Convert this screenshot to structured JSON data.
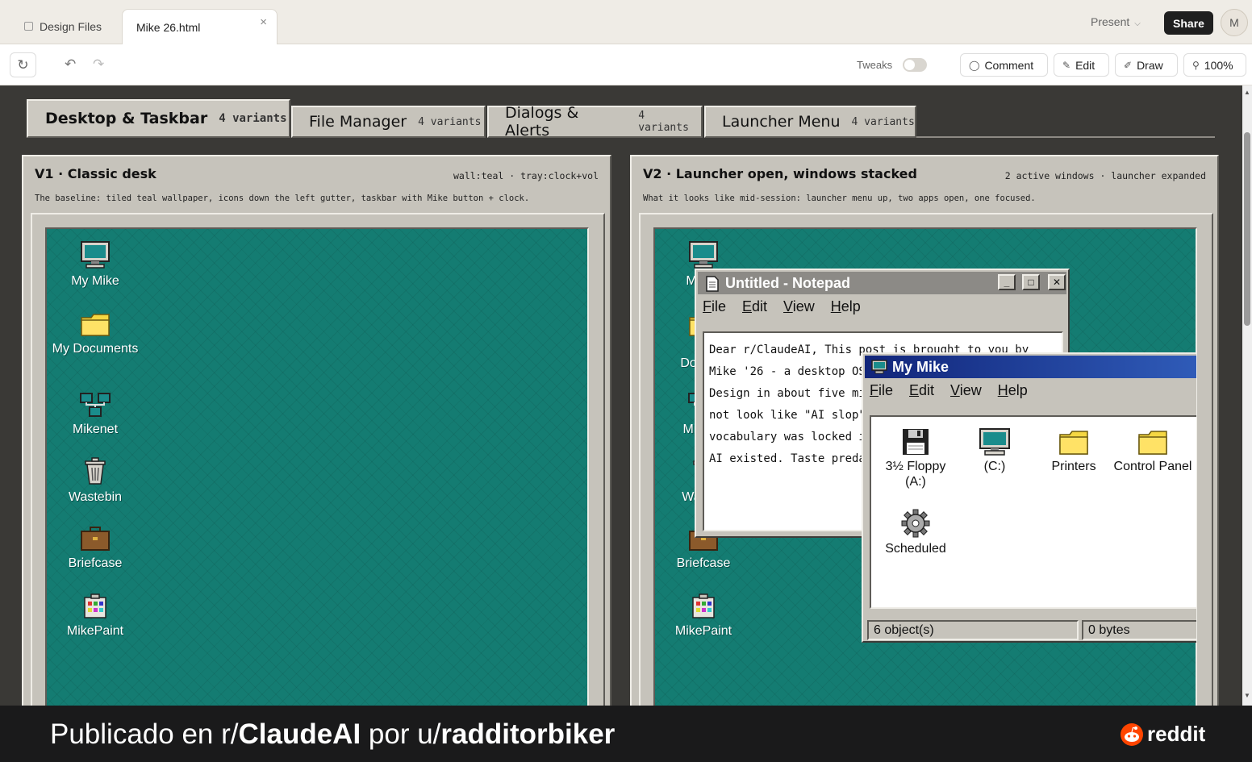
{
  "tabs": {
    "design_files": "Design Files",
    "current_file": "Mike 26.html",
    "close_glyph": "×"
  },
  "header": {
    "present": "Present",
    "share": "Share",
    "avatar": "M"
  },
  "toolbar": {
    "tweaks": "Tweaks",
    "comment": "Comment",
    "edit": "Edit",
    "draw": "Draw",
    "zoom": "100%"
  },
  "variant_tabs": [
    {
      "label": "Desktop & Taskbar",
      "count": "4 variants",
      "active": true
    },
    {
      "label": "File Manager",
      "count": "4 variants"
    },
    {
      "label": "Dialogs & Alerts",
      "count": "4 variants"
    },
    {
      "label": "Launcher Menu",
      "count": "4 variants"
    }
  ],
  "cards": [
    {
      "title": "V1 · Classic desk",
      "meta": "wall:teal · tray:clock+vol",
      "desc": "The baseline: tiled teal wallpaper, icons down the left gutter, taskbar with Mike button + clock."
    },
    {
      "title": "V2 · Launcher open, windows stacked",
      "meta": "2 active windows · launcher expanded",
      "desc": "What it looks like mid-session: launcher menu up, two apps open, one focused."
    }
  ],
  "desktop_icons": [
    {
      "label": "My Mike",
      "icon": "computer-icon"
    },
    {
      "label": "My Documents",
      "icon": "folder-icon"
    },
    {
      "label": "Mikenet",
      "icon": "network-icon"
    },
    {
      "label": "Wastebin",
      "icon": "trash-icon"
    },
    {
      "label": "Briefcase",
      "icon": "briefcase-icon"
    },
    {
      "label": "MikePaint",
      "icon": "paint-icon"
    }
  ],
  "v2_icon_labels": {
    "my_mike": "My",
    "documents": "Docu",
    "mikenet": "Mi",
    "wastebin": "Was",
    "briefcase": "Briefcase",
    "mikepaint": "MikePaint"
  },
  "notepad": {
    "title": "Untitled - Notepad",
    "menu": [
      "File",
      "Edit",
      "View",
      "Help"
    ],
    "lines": [
      "Dear r/ClaudeAI, This post is brought to you by",
      "Mike '26 - a desktop OS",
      "Design in about five mi",
      "not look like \"AI slop\"",
      "vocabulary was locked i",
      "AI existed. Taste preda"
    ]
  },
  "mymike_window": {
    "title": "My Mike",
    "menu": [
      "File",
      "Edit",
      "View",
      "Help"
    ],
    "items": [
      {
        "label": "3½ Floppy (A:)",
        "icon": "floppy-icon"
      },
      {
        "label": "(C:)",
        "icon": "drive-icon"
      },
      {
        "label": "Printers",
        "icon": "folder-icon"
      },
      {
        "label": "Control Panel",
        "icon": "folder-icon"
      },
      {
        "label": "Scheduled",
        "icon": "gear-icon"
      }
    ],
    "status_objects": "6 object(s)",
    "status_bytes": "0 bytes"
  },
  "banner": {
    "prefix": "Publicado en r/",
    "subreddit": "ClaudeAI",
    "middle": " por u/",
    "user": "radditorbiker",
    "logo": "reddit"
  },
  "colors": {
    "wallpaper": "#147c72",
    "chrome": "#c6c3bb",
    "active_title": "#11257a",
    "inactive_title": "#8c8a86",
    "share_bg": "#1f1f1f",
    "reddit_orange": "#ff4500"
  }
}
